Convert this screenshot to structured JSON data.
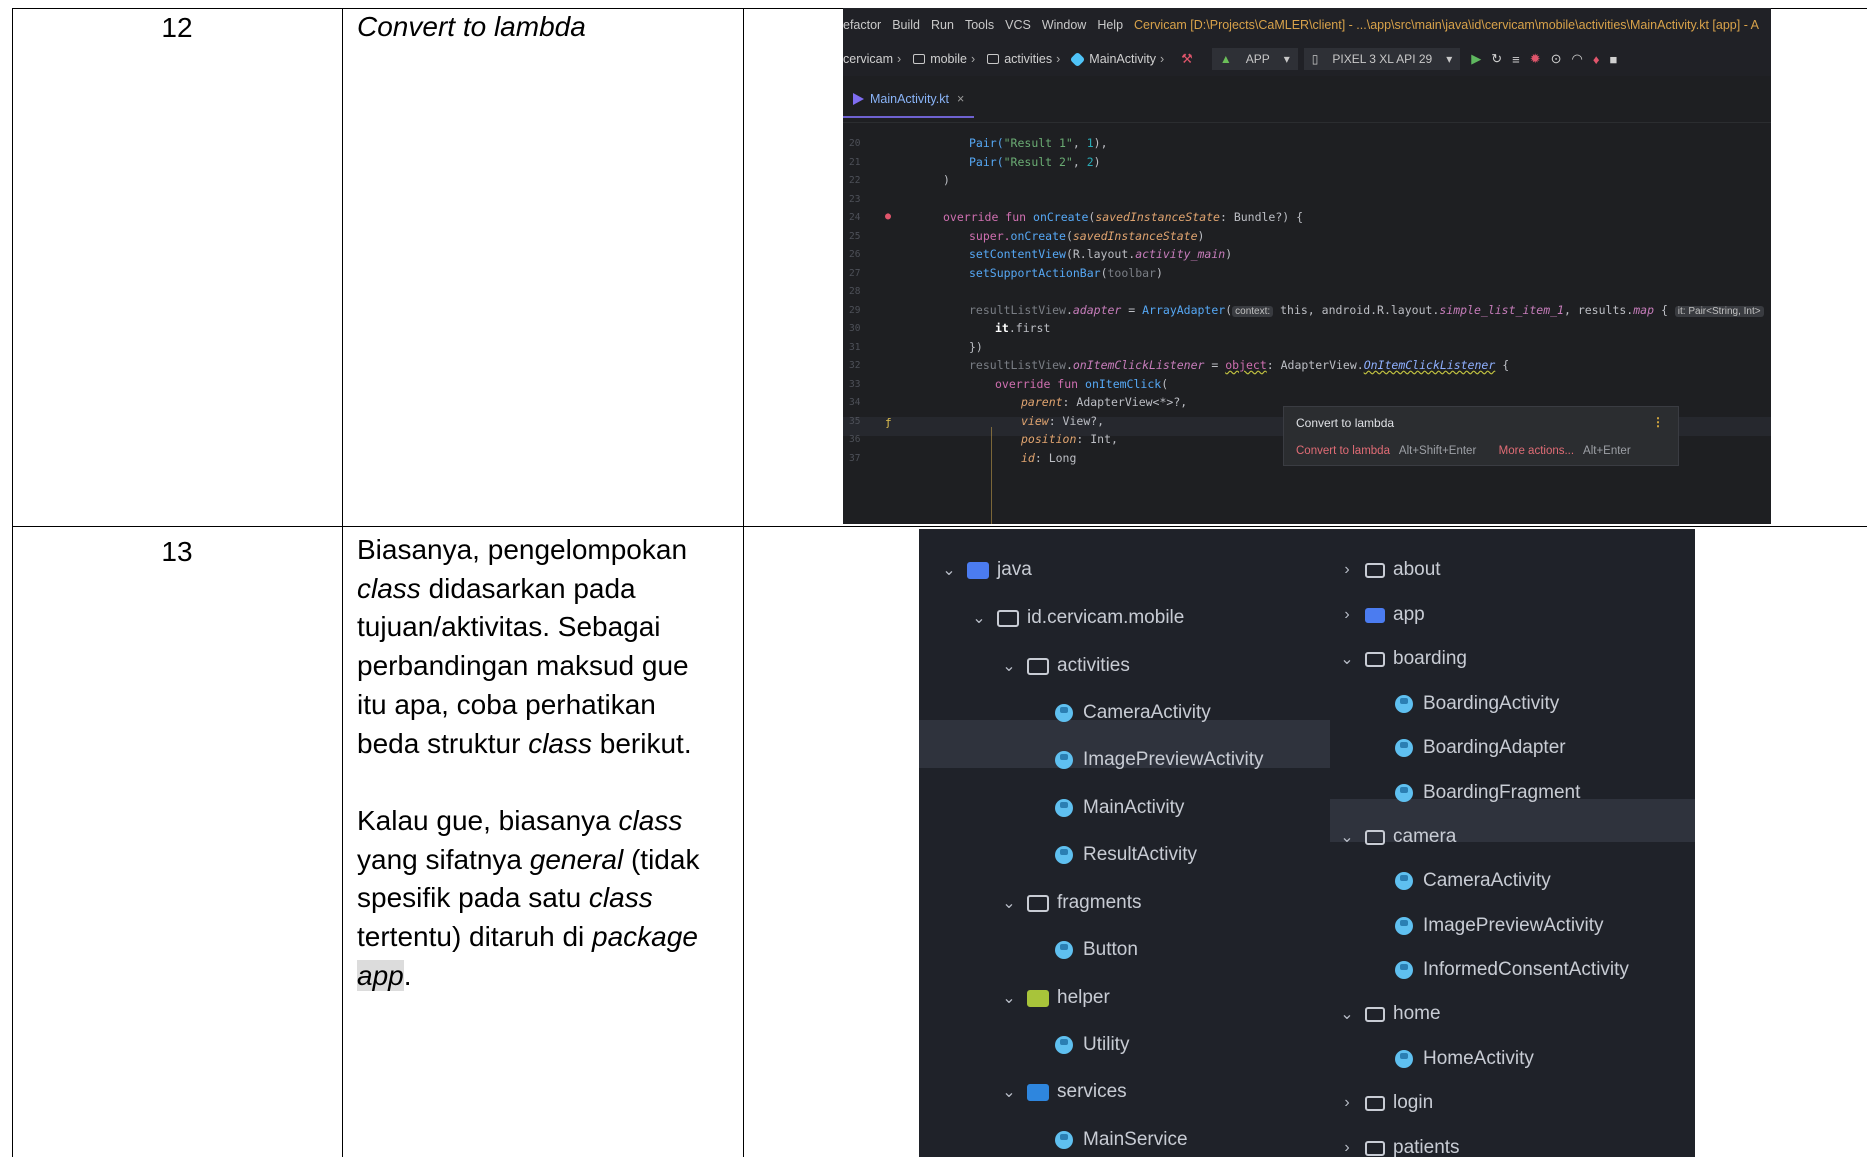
{
  "rows": [
    {
      "number": "12",
      "text": "Convert to lambda"
    },
    {
      "number": "13",
      "paragraph1": [
        {
          "t": "Biasanya, pengelompokan",
          "i": false
        },
        {
          "t": "class",
          "i": true
        },
        {
          "t": "didasarkan pada",
          "i": false
        },
        {
          "t": "tujuan/aktivitas. Sebagai",
          "i": false
        },
        {
          "t": "perbandingan maksud gue",
          "i": false
        },
        {
          "t": "itu apa, coba perhatikan",
          "i": false
        },
        {
          "t": "beda struktur",
          "i": false
        },
        {
          "t": "class",
          "i": true
        },
        {
          "t": "berikut.",
          "i": false
        }
      ],
      "paragraph2": [
        {
          "t": "Kalau gue, biasanya",
          "i": false
        },
        {
          "t": "class",
          "i": true
        },
        {
          "t": "yang sifatnya",
          "i": false
        },
        {
          "t": "general",
          "i": true
        },
        {
          "t": "(tidak",
          "i": false
        },
        {
          "t": "spesifik pada satu",
          "i": false
        },
        {
          "t": "class",
          "i": true
        },
        {
          "t": "tertentu) ditaruh di",
          "i": false
        },
        {
          "t": "package",
          "i": true
        },
        {
          "t": "app",
          "i": true
        },
        {
          "t": ".",
          "i": false
        }
      ]
    }
  ],
  "ide": {
    "menu": [
      "efactor",
      "Build",
      "Run",
      "Tools",
      "VCS",
      "Window",
      "Help"
    ],
    "window_path": "Cervicam [D:\\Projects\\CaMLER\\client] - ...\\app\\src\\main\\java\\id\\cervicam\\mobile\\activities\\MainActivity.kt [app] - A",
    "breadcrumbs": [
      "cervicam",
      "mobile",
      "activities",
      "MainActivity"
    ],
    "run_config": "APP",
    "device": "PIXEL 3 XL API 29",
    "tab": "MainActivity.kt",
    "line_numbers": [
      "20",
      "21",
      "22",
      "23",
      "24",
      "25",
      "26",
      "27",
      "28",
      "29",
      "30",
      "31",
      "32",
      "33",
      "34",
      "35",
      "36",
      "37"
    ],
    "code": {
      "l20": [
        "Pair(",
        "\"Result 1\"",
        ", ",
        "1",
        "),"
      ],
      "l21": [
        "Pair(",
        "\"Result 2\"",
        ", ",
        "2",
        ")"
      ],
      "l22": ")",
      "l24": [
        "override fun ",
        "onCreate",
        "(",
        "savedInstanceState",
        ": Bundle?) {"
      ],
      "l25": [
        "super.",
        "onCreate",
        "(",
        "savedInstanceState",
        ")"
      ],
      "l26": [
        "setContentView",
        "(R.layout.",
        "activity_main",
        ")"
      ],
      "l27": [
        "setSupportActionBar",
        "(",
        "toolbar",
        ")"
      ],
      "l29": [
        "resultListView",
        ".",
        "adapter",
        " = ",
        "ArrayAdapter",
        "(",
        "context:",
        " this, android.R.layout.",
        "simple_list_item_1",
        ", results.",
        "map",
        " { ",
        "it: Pair<String, Int>"
      ],
      "l30": [
        "it",
        ".first"
      ],
      "l31": "})",
      "l32": [
        "resultListView",
        ".",
        "onItemClickListener",
        " = ",
        "object",
        ": AdapterView.",
        "OnItemClickListener",
        " {"
      ],
      "l33": [
        "override fun ",
        "onItemClick",
        "("
      ],
      "l34": [
        "parent",
        ": AdapterView<*>?,"
      ],
      "l35": [
        "view",
        ": View?,"
      ],
      "l36": [
        "position",
        ": Int,"
      ],
      "l37": [
        "id",
        ": Long"
      ]
    },
    "popup": {
      "title": "Convert to lambda",
      "action": "Convert to lambda",
      "action_keys": "Alt+Shift+Enter",
      "more": "More actions...",
      "more_keys": "Alt+Enter"
    }
  },
  "tree_left": {
    "java": "java",
    "package": "id.cervicam.mobile",
    "activities": "activities",
    "camera_activity": "CameraActivity",
    "image_preview_activity": "ImagePreviewActivity",
    "main_activity": "MainActivity",
    "result_activity": "ResultActivity",
    "fragments": "fragments",
    "button": "Button",
    "helper": "helper",
    "utility": "Utility",
    "services": "services",
    "main_service": "MainService"
  },
  "tree_right": {
    "about": "about",
    "app": "app",
    "boarding": "boarding",
    "boarding_activity": "BoardingActivity",
    "boarding_adapter": "BoardingAdapter",
    "boarding_fragment": "BoardingFragment",
    "camera": "camera",
    "camera_activity": "CameraActivity",
    "image_preview_activity": "ImagePreviewActivity",
    "informed_consent_activity": "InformedConsentActivity",
    "home": "home",
    "home_activity": "HomeActivity",
    "login": "login",
    "patients": "patients"
  }
}
